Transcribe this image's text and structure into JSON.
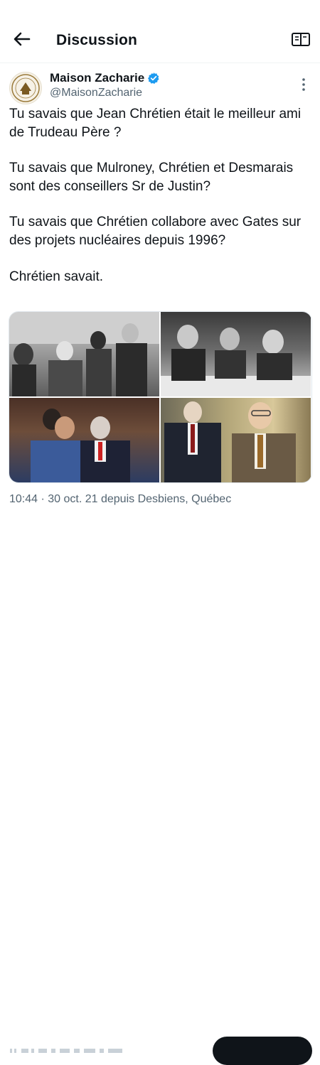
{
  "header": {
    "title": "Discussion",
    "back_icon": "arrow-left-icon",
    "reader_icon": "reader-mode-icon"
  },
  "author": {
    "name": "Maison Zacharie",
    "handle": "@MaisonZacharie",
    "verified_color": "#1d9bf0"
  },
  "tweet": {
    "paragraphs": [
      "Tu savais que Jean Chrétien était le meilleur ami de Trudeau Père ?",
      "Tu savais que Mulroney, Chrétien et Desmarais sont des conseillers Sr de Justin?",
      "Tu savais que Chrétien collabore avec Gates sur des projets nucléaires depuis 1996?",
      "Chrétien savait."
    ]
  },
  "media": {
    "count": 4
  },
  "meta": {
    "text": "10:44 · 30 oct. 21 depuis Desbiens, Québec"
  },
  "colors": {
    "text": "#0f1419",
    "secondary": "#536471",
    "accent": "#1d9bf0"
  }
}
